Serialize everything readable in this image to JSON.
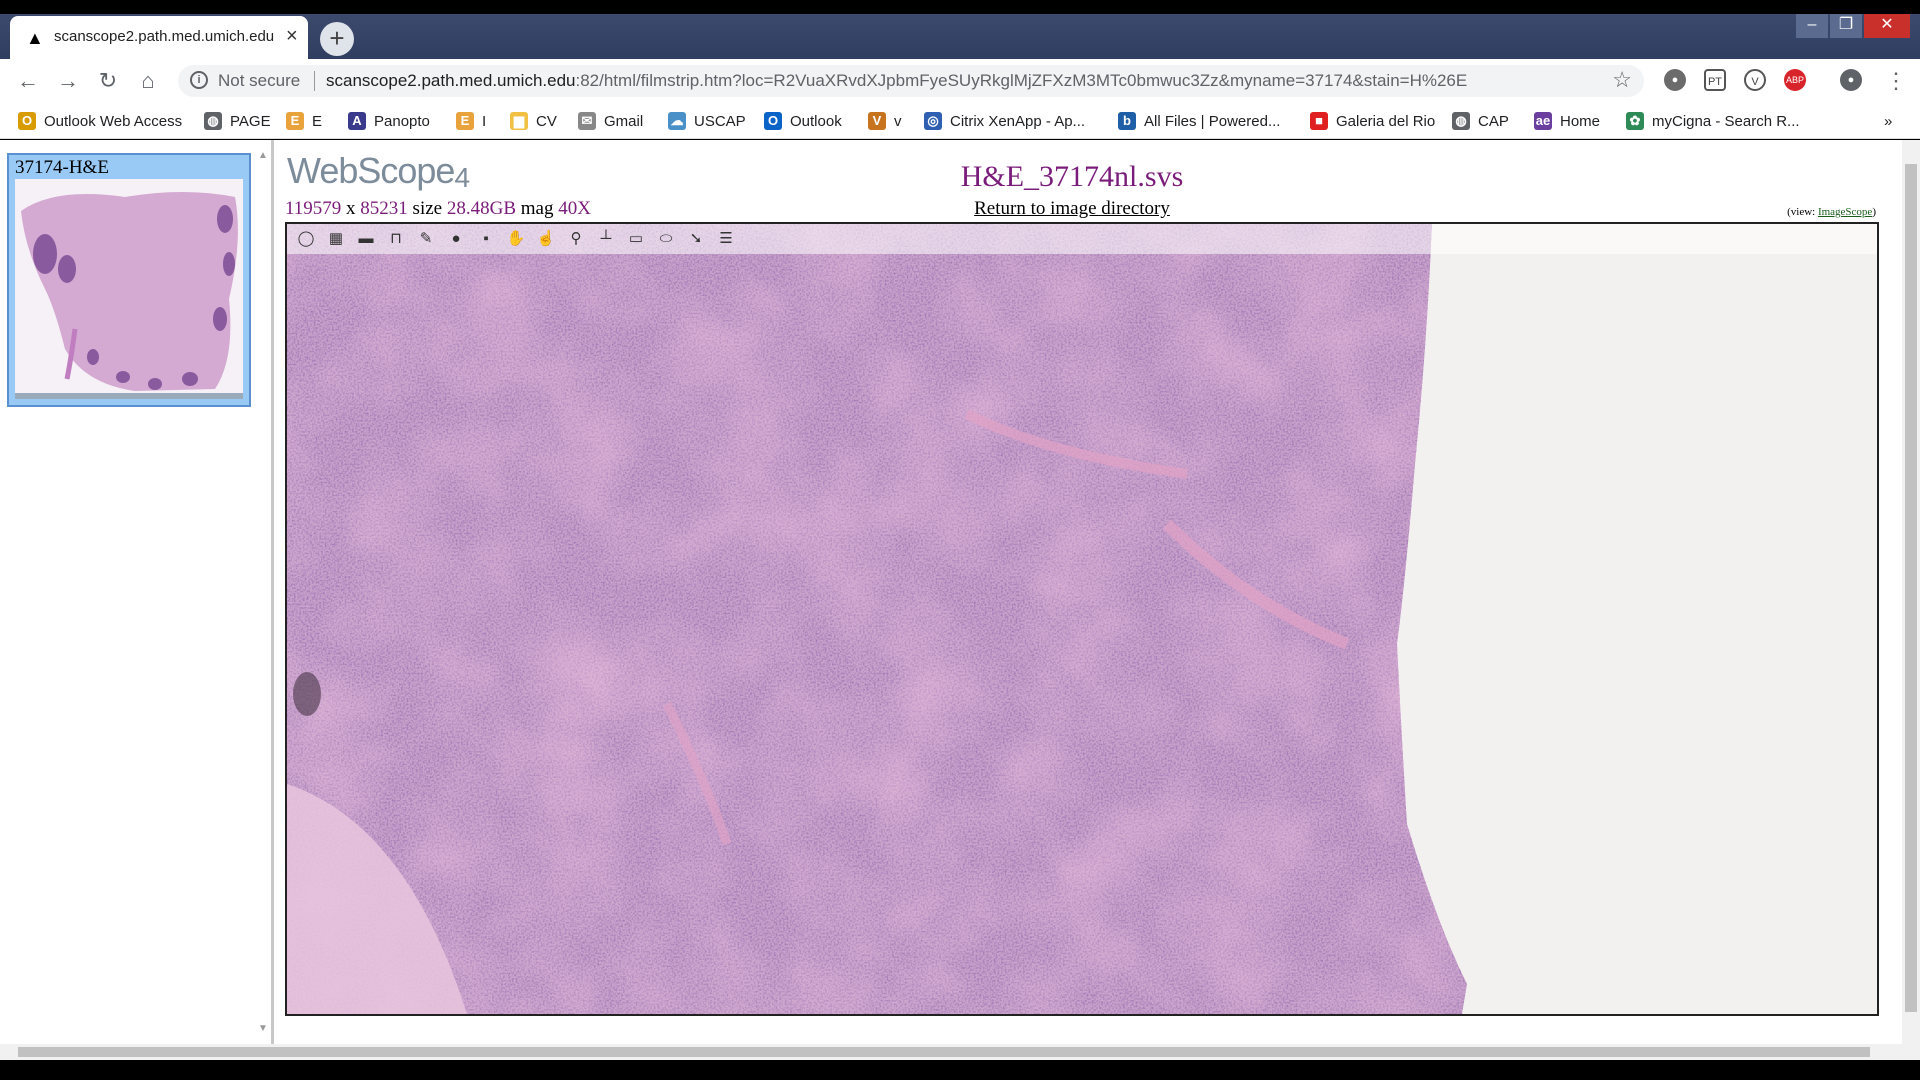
{
  "browser": {
    "tab": {
      "favicon": "path-logo-icon",
      "title": "scanscope2.path.med.umich.edu"
    },
    "omnibox": {
      "security_label": "Not secure",
      "url_host": "scanscope2.path.med.umich.edu",
      "url_path": ":82/html/filmstrip.htm?loc=R2VuaXRvdXJpbmFyeSUyRkglMjZFXzM3MTc0bmwuc3Zz&myname=37174&stain=H%26E"
    },
    "bookmarks": [
      {
        "label": "Outlook Web Access",
        "icon": "owa-icon",
        "color": "#d89b00"
      },
      {
        "label": "PAGE",
        "icon": "globe-icon",
        "color": "#5f6368"
      },
      {
        "label": "E",
        "icon": "e-icon",
        "color": "#e8a33d"
      },
      {
        "label": "Panopto",
        "icon": "panopto-icon",
        "color": "#3a3a8c"
      },
      {
        "label": "I",
        "icon": "e-icon",
        "color": "#e8a33d"
      },
      {
        "label": "CV",
        "icon": "folder-icon",
        "color": "#f2c042"
      },
      {
        "label": "Gmail",
        "icon": "gmail-icon",
        "color": "#888888"
      },
      {
        "label": "USCAP",
        "icon": "cloud-icon",
        "color": "#4a90c8"
      },
      {
        "label": "Outlook",
        "icon": "outlook-icon",
        "color": "#0a64c8"
      },
      {
        "label": "v",
        "icon": "v-icon",
        "color": "#c8731e"
      },
      {
        "label": "Citrix XenApp - Ap...",
        "icon": "citrix-icon",
        "color": "#2f5fb0"
      },
      {
        "label": "All Files | Powered...",
        "icon": "box-icon",
        "color": "#1f5fa8"
      },
      {
        "label": "Galeria del Rio",
        "icon": "square-icon",
        "color": "#e02020"
      },
      {
        "label": "CAP",
        "icon": "globe-icon",
        "color": "#5f6368"
      },
      {
        "label": "Home",
        "icon": "ae-icon",
        "color": "#6a3fa0"
      },
      {
        "label": "myCigna - Search R...",
        "icon": "cigna-icon",
        "color": "#2e8b57"
      }
    ],
    "bookmarks_more": "»"
  },
  "sidebar": {
    "thumbnail_label": "37174-H&E"
  },
  "viewer": {
    "logo_text": "WebScope",
    "logo_version": "4",
    "width_px": "119579",
    "height_px": "85231",
    "size_label": "size",
    "size_value": "28.48GB",
    "mag_label": "mag",
    "mag_value": "40X",
    "x_sep": "x",
    "slide_title": "H&E_37174nl.svs",
    "return_link": "Return to image directory",
    "view_prefix": "(view: ",
    "view_link": "ImageScope",
    "view_suffix": ")",
    "tools": [
      "navigate-icon",
      "thumbnail-icon",
      "zoom-bar-icon",
      "slide-label-icon",
      "annotations-icon",
      "color-icon",
      "save-icon",
      "pan-icon",
      "pointer-icon",
      "pin-icon",
      "ruler-icon",
      "rectangle-icon",
      "ellipse-icon",
      "arrow-icon",
      "menu-icon"
    ]
  }
}
